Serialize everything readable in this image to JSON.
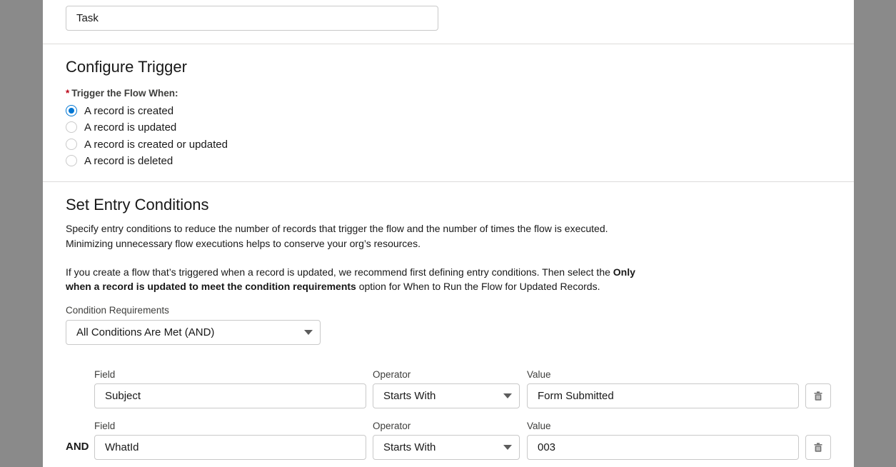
{
  "object_field": {
    "value": "Task"
  },
  "configure_trigger": {
    "title": "Configure Trigger",
    "required_mark": "*",
    "label": "Trigger the Flow When:",
    "options": [
      {
        "label": "A record is created",
        "checked": true
      },
      {
        "label": "A record is updated",
        "checked": false
      },
      {
        "label": "A record is created or updated",
        "checked": false
      },
      {
        "label": "A record is deleted",
        "checked": false
      }
    ]
  },
  "entry_conditions": {
    "title": "Set Entry Conditions",
    "description_line1": "Specify entry conditions to reduce the number of records that trigger the flow and the number of times the flow is executed.",
    "description_line2": "Minimizing unnecessary flow executions helps to conserve your org’s resources.",
    "note_line1_prefix": "If you create a flow that’s triggered when a record is updated, we recommend first defining entry conditions. Then select the ",
    "note_line1_bold": "Only",
    "note_line2_bold": "when a record is updated to meet the condition requirements",
    "note_line2_suffix": " option for When to Run the Flow for Updated Records.",
    "requirements_label": "Condition Requirements",
    "requirements_value": "All Conditions Are Met (AND)",
    "column_labels": {
      "field": "Field",
      "operator": "Operator",
      "value": "Value"
    },
    "conditions": [
      {
        "connector": "",
        "field": "Subject",
        "operator": "Starts With",
        "value": "Form Submitted"
      },
      {
        "connector": "AND",
        "field": "WhatId",
        "operator": "Starts With",
        "value": "003"
      }
    ]
  },
  "icons": {
    "delete": "trash-icon",
    "dropdown": "chevron-down-icon"
  },
  "colors": {
    "accent": "#0176d3",
    "backdrop": "#8a8a8a"
  }
}
